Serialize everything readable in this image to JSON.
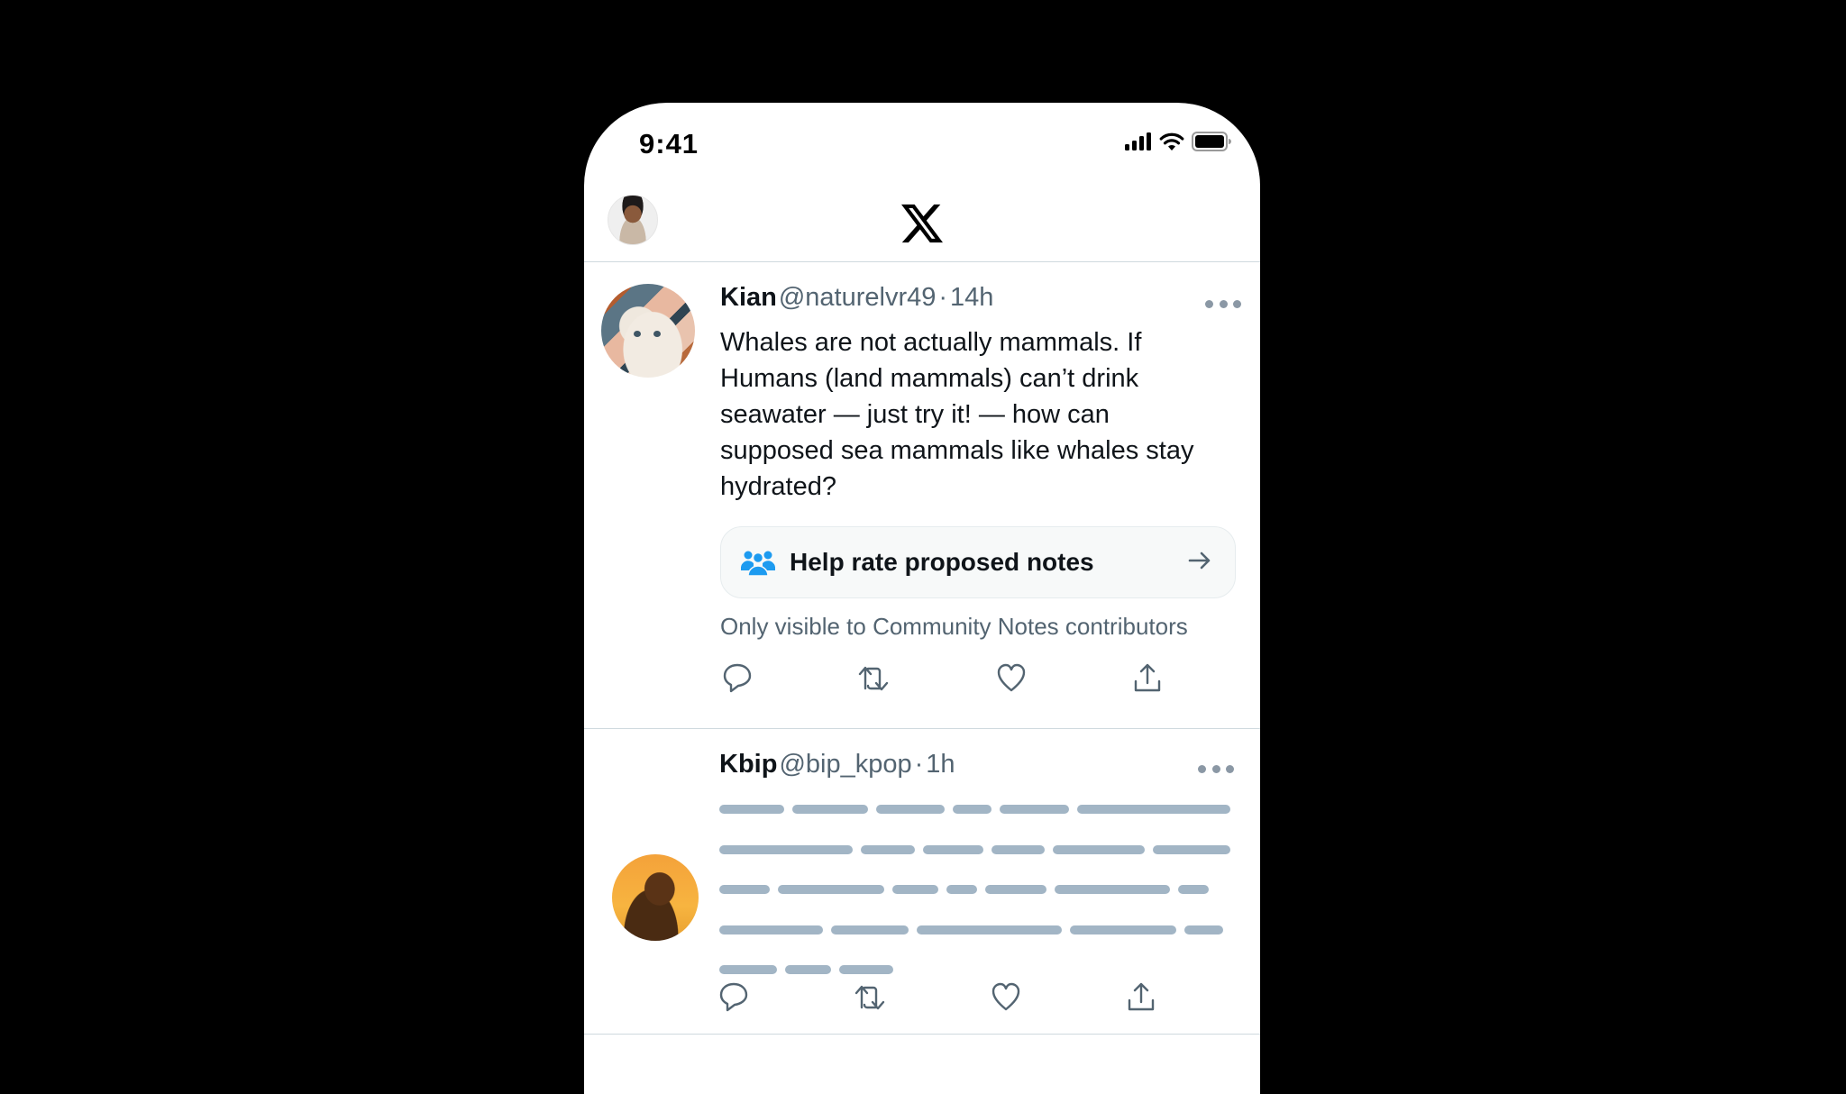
{
  "status_bar": {
    "time": "9:41",
    "icons": [
      "cellular-signal-icon",
      "wifi-icon",
      "battery-icon"
    ]
  },
  "header": {
    "logo": "x-logo-icon",
    "profile_avatar": "current-user-avatar"
  },
  "feed": {
    "tweets": [
      {
        "name": "Kian",
        "handle": "@naturelvr49",
        "separator": "·",
        "time": "14h",
        "avatar": "cat-illustration-avatar",
        "body": "Whales are not actually mammals. If Humans (land mammals) can’t drink seawater — just try it! — how can supposed sea mammals like whales stay hydrated?",
        "notes_card": {
          "label": "Help rate proposed notes",
          "icon": "people-icon",
          "arrow": "arrow-right-icon"
        },
        "visibility_note": "Only visible to Community Notes contributors",
        "actions": [
          "reply",
          "repost",
          "like",
          "share"
        ]
      },
      {
        "name": "Kbip",
        "handle": "@bip_kpop",
        "separator": "·",
        "time": "1h",
        "avatar": "person-sunset-avatar",
        "body_placeholder": "skeleton-text",
        "actions": [
          "reply",
          "repost",
          "like",
          "share"
        ]
      }
    ]
  },
  "colors": {
    "text_primary": "#0F1419",
    "text_secondary": "#536471",
    "accent_blue": "#1D9BF0",
    "skeleton": "#A2B5C5",
    "divider": "#CFD9DE",
    "card_bg": "#F7F9F9"
  }
}
